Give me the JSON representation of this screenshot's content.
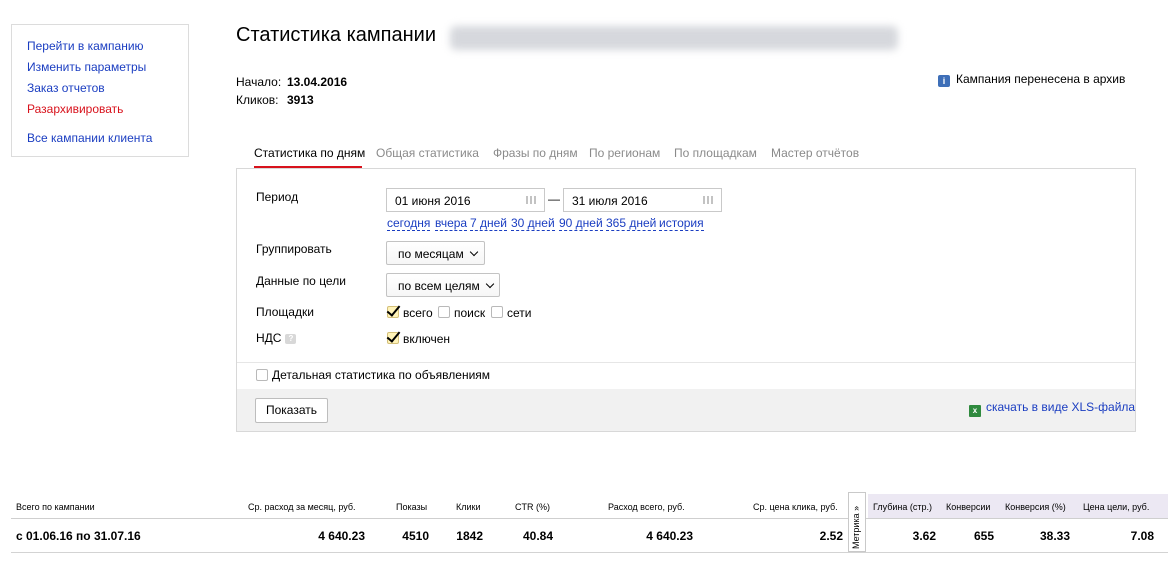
{
  "sidebar": {
    "links": [
      {
        "label": "Перейти в кампанию"
      },
      {
        "label": "Изменить параметры"
      },
      {
        "label": "Заказ отчетов"
      },
      {
        "label": "Разархивировать",
        "color": "#d8121c"
      },
      {
        "label": "Все кампании клиента"
      }
    ]
  },
  "header": {
    "title": "Статистика кампании",
    "start_label": "Начало:",
    "start_value": "13.04.2016",
    "clicks_label": "Кликов:",
    "clicks_value": "3913",
    "archive_notice": "Кампания перенесена в архив",
    "archive_icon": "info-icon"
  },
  "tabs": [
    {
      "label": "Статистика по дням",
      "active": true
    },
    {
      "label": "Общая статистика"
    },
    {
      "label": "Фразы по дням"
    },
    {
      "label": "По регионам"
    },
    {
      "label": "По площадкам"
    },
    {
      "label": "Мастер отчётов"
    }
  ],
  "form": {
    "period_label": "Период",
    "date_from": "01 июня 2016",
    "date_sep": "—",
    "date_to": "31 июля 2016",
    "quick_ranges": [
      "сегодня",
      "вчера",
      "7 дней",
      "30 дней",
      "90 дней",
      "365 дней",
      "история"
    ],
    "group_label": "Группировать",
    "group_value": "по месяцам",
    "goal_label": "Данные по цели",
    "goal_value": "по всем целям",
    "platforms_label": "Площадки",
    "platforms": [
      {
        "label": "всего",
        "checked": true
      },
      {
        "label": "поиск",
        "checked": false
      },
      {
        "label": "сети",
        "checked": false
      }
    ],
    "vat_label": "НДС",
    "vat_help": "?",
    "vat_option": {
      "label": "включен",
      "checked": true
    },
    "detailed_option": {
      "label": "Детальная статистика по объявлениям",
      "checked": false
    },
    "show_button": "Показать",
    "xls_link": "скачать в виде XLS-файла"
  },
  "stats": {
    "metrika_tab": "Метрика »",
    "headers": [
      "Всего по кампании",
      "Ср. расход за месяц, руб.",
      "Показы",
      "Клики",
      "CTR (%)",
      "Расход всего, руб.",
      "Ср. цена клика, руб.",
      "Глубина (стр.)",
      "Конверсии",
      "Конверсия (%)",
      "Цена цели, руб."
    ],
    "row": [
      "с 01.06.16 по 31.07.16",
      "4 640.23",
      "4510",
      "1842",
      "40.84",
      "4 640.23",
      "2.52",
      "3.62",
      "655",
      "38.33",
      "7.08"
    ]
  },
  "colors": {
    "accent_red": "#d8121c",
    "link_blue": "#1a3dc1",
    "metrika_bg": "#ece8f3"
  }
}
